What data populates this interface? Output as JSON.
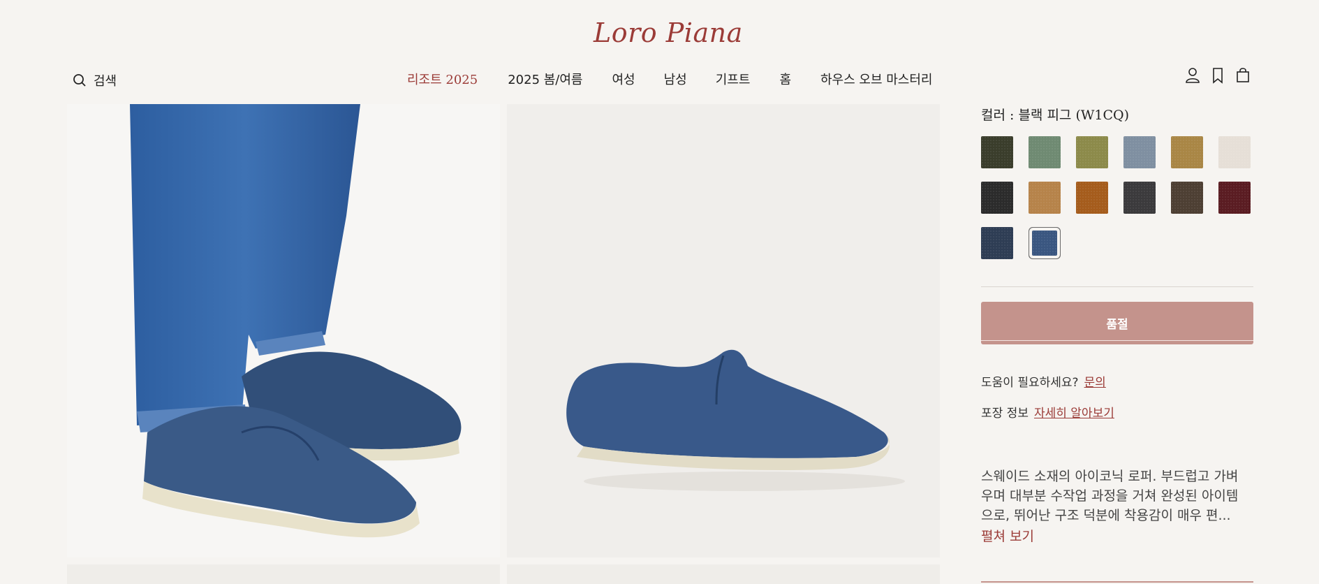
{
  "brand": {
    "name": "Loro Piana",
    "color": "#9b3b37"
  },
  "header": {
    "search_label": "검색",
    "nav": [
      {
        "label": "리조트 2025",
        "active": true
      },
      {
        "label": "2025 봄/여름"
      },
      {
        "label": "여성"
      },
      {
        "label": "남성"
      },
      {
        "label": "기프트"
      },
      {
        "label": "홈"
      },
      {
        "label": "하우스 오브 마스터리"
      }
    ],
    "icons": [
      "search-icon",
      "account-icon",
      "wishlist-icon",
      "shopping-bag-icon"
    ]
  },
  "product": {
    "color_label": "컬러 : 블랙 피그 (W1CQ)",
    "swatches": [
      {
        "color": "#3a3d2b"
      },
      {
        "color": "#6f8a72"
      },
      {
        "color": "#8c8a4a"
      },
      {
        "color": "#7f8fa1"
      },
      {
        "color": "#a98645"
      },
      {
        "color": "#e6dfd7"
      },
      {
        "color": "#2b2b2b"
      },
      {
        "color": "#b6834a"
      },
      {
        "color": "#a55c1c"
      },
      {
        "color": "#3b3a3c"
      },
      {
        "color": "#4d3f33"
      },
      {
        "color": "#5a1c22"
      },
      {
        "color": "#2e3d54"
      },
      {
        "color": "#3a5680",
        "selected": true
      }
    ],
    "soldout_label": "품절",
    "help_text": "도움이 필요하세요?",
    "help_link": "문의",
    "pack_text": "포장 정보",
    "pack_link": "자세히 알아보기",
    "description": "스웨이드 소재의 아이코닉 로퍼. 부드럽고 가벼우며 대부분 수작업 과정을 거쳐 완성된 아이템으로, 뛰어난 구조 덕분에 착용감이 매우 편...",
    "more_label": "펼쳐 보기"
  }
}
